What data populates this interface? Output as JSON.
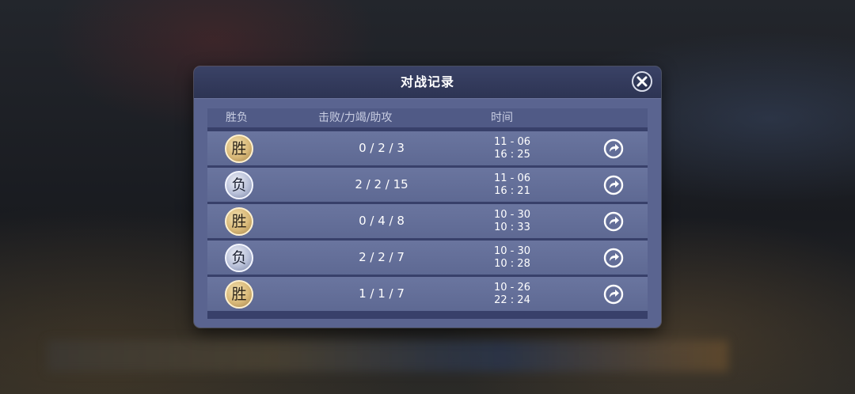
{
  "dialog": {
    "title": "对战记录",
    "columns": {
      "result": "胜负",
      "kda": "击败/力竭/助攻",
      "time": "时间"
    },
    "rows": [
      {
        "result": "胜",
        "type": "win",
        "kda": "0 / 2 / 3",
        "date": "11 - 06",
        "clock": "16 : 25"
      },
      {
        "result": "负",
        "type": "loss",
        "kda": "2 / 2 / 15",
        "date": "11 - 06",
        "clock": "16 : 21"
      },
      {
        "result": "胜",
        "type": "win",
        "kda": "0 / 4 / 8",
        "date": "10 - 30",
        "clock": "10 : 33"
      },
      {
        "result": "负",
        "type": "loss",
        "kda": "2 / 2 / 7",
        "date": "10 - 30",
        "clock": "10 : 28"
      },
      {
        "result": "胜",
        "type": "win",
        "kda": "1 / 1 / 7",
        "date": "10 - 26",
        "clock": "22 : 24"
      }
    ]
  },
  "icons": {
    "close": "close-icon",
    "replay": "share-arrow-icon"
  },
  "colors": {
    "win_badge": "#d8b878",
    "loss_badge": "#b8c0d8",
    "panel": "#5a6490",
    "header": "#2d3453"
  }
}
